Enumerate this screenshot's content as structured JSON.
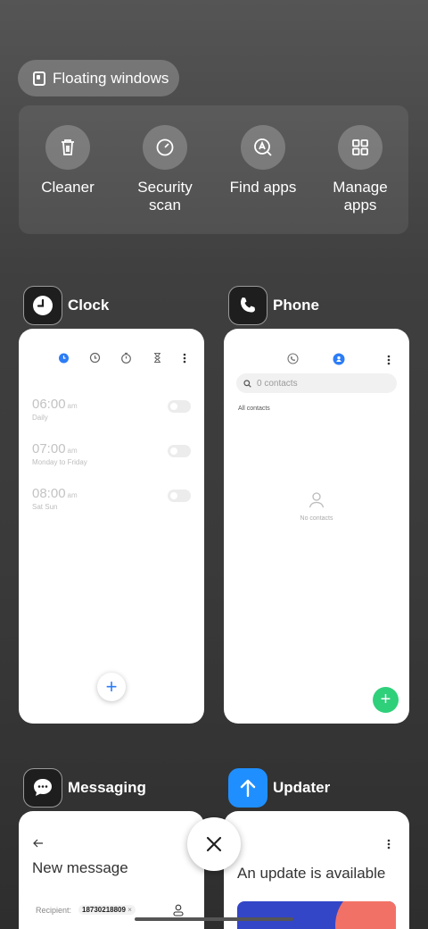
{
  "floating_windows": {
    "label": "Floating windows",
    "icon": "floating-window-icon"
  },
  "tools": [
    {
      "label": "Cleaner",
      "icon": "trash-icon"
    },
    {
      "label": "Security\nscan",
      "icon": "security-scan-icon"
    },
    {
      "label": "Find apps",
      "icon": "find-apps-icon"
    },
    {
      "label": "Manage\napps",
      "icon": "grid-icon"
    }
  ],
  "apps": {
    "clock": {
      "name": "Clock",
      "alarms": [
        {
          "time": "06:00",
          "ampm": "am",
          "repeat": "Daily"
        },
        {
          "time": "07:00",
          "ampm": "am",
          "repeat": "Monday to Friday"
        },
        {
          "time": "08:00",
          "ampm": "am",
          "repeat": "Sat Sun"
        }
      ],
      "add": "+"
    },
    "phone": {
      "name": "Phone",
      "search_placeholder": "0 contacts",
      "section": "All contacts",
      "empty": "No contacts",
      "add": "+"
    },
    "messaging": {
      "name": "Messaging",
      "title": "New message",
      "recipient_label": "Recipient:",
      "recipient_chip": "18730218809"
    },
    "updater": {
      "name": "Updater",
      "title": "An update is available"
    }
  },
  "colors": {
    "accent_blue": "#2c7cf6",
    "accent_green": "#2fd07a",
    "updater_blue": "#1f8fff"
  }
}
